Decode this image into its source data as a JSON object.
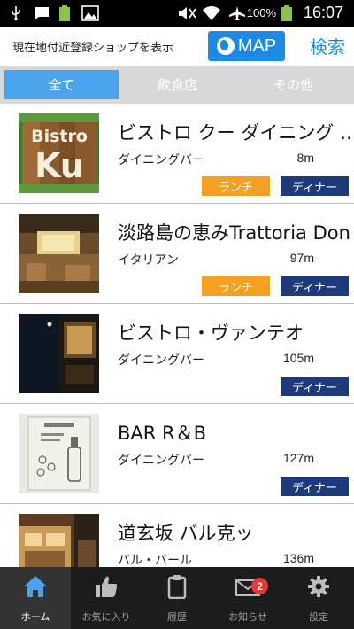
{
  "status_bar": {
    "battery_percent": "100%",
    "time": "16:07",
    "left_icons": [
      "usb-icon",
      "message-icon",
      "battery-small-icon",
      "image-icon"
    ],
    "right_icons": [
      "mute-icon",
      "wifi-icon",
      "airplane-icon",
      "battery-icon"
    ]
  },
  "header": {
    "nearby_label": "現在地付近登録ショップを表示",
    "map_label": "MAP",
    "search_label": "検索"
  },
  "tabs": [
    {
      "label": "全て",
      "active": true
    },
    {
      "label": "飲食店",
      "active": false
    },
    {
      "label": "その他",
      "active": false
    }
  ],
  "shops": [
    {
      "name": "ビストロ クー ダイニング …",
      "category": "ダイニングバー",
      "distance": "8m",
      "tags": [
        "ランチ",
        "ディナー"
      ],
      "thumb_text": [
        "Bistro",
        "Ku"
      ]
    },
    {
      "name": "淡路島の恵みTrattoria Doni",
      "category": "イタリアン",
      "distance": "97m",
      "tags": [
        "ランチ",
        "ディナー"
      ]
    },
    {
      "name": "ビストロ・ヴァンテオ",
      "category": "ダイニングバー",
      "distance": "105m",
      "tags": [
        "ディナー"
      ]
    },
    {
      "name": "BAR R＆B",
      "category": "ダイニングバー",
      "distance": "127m",
      "tags": [
        "ディナー"
      ]
    },
    {
      "name": "道玄坂 バル克ッ",
      "category": "バル・バール",
      "distance": "136m",
      "tags": []
    }
  ],
  "bottom_nav": [
    {
      "label": "ホーム",
      "icon": "home-icon",
      "active": true
    },
    {
      "label": "お気に入り",
      "icon": "thumbs-up-icon",
      "active": false
    },
    {
      "label": "履歴",
      "icon": "clipboard-icon",
      "active": false
    },
    {
      "label": "お知らせ",
      "icon": "mail-icon",
      "active": false,
      "badge": "2"
    },
    {
      "label": "設定",
      "icon": "gear-icon",
      "active": false
    }
  ],
  "colors": {
    "accent_blue": "#1e88e5",
    "tab_active": "#4ba3ec",
    "lunch_tag": "#f5a023",
    "dinner_tag": "#1d3a7a"
  }
}
